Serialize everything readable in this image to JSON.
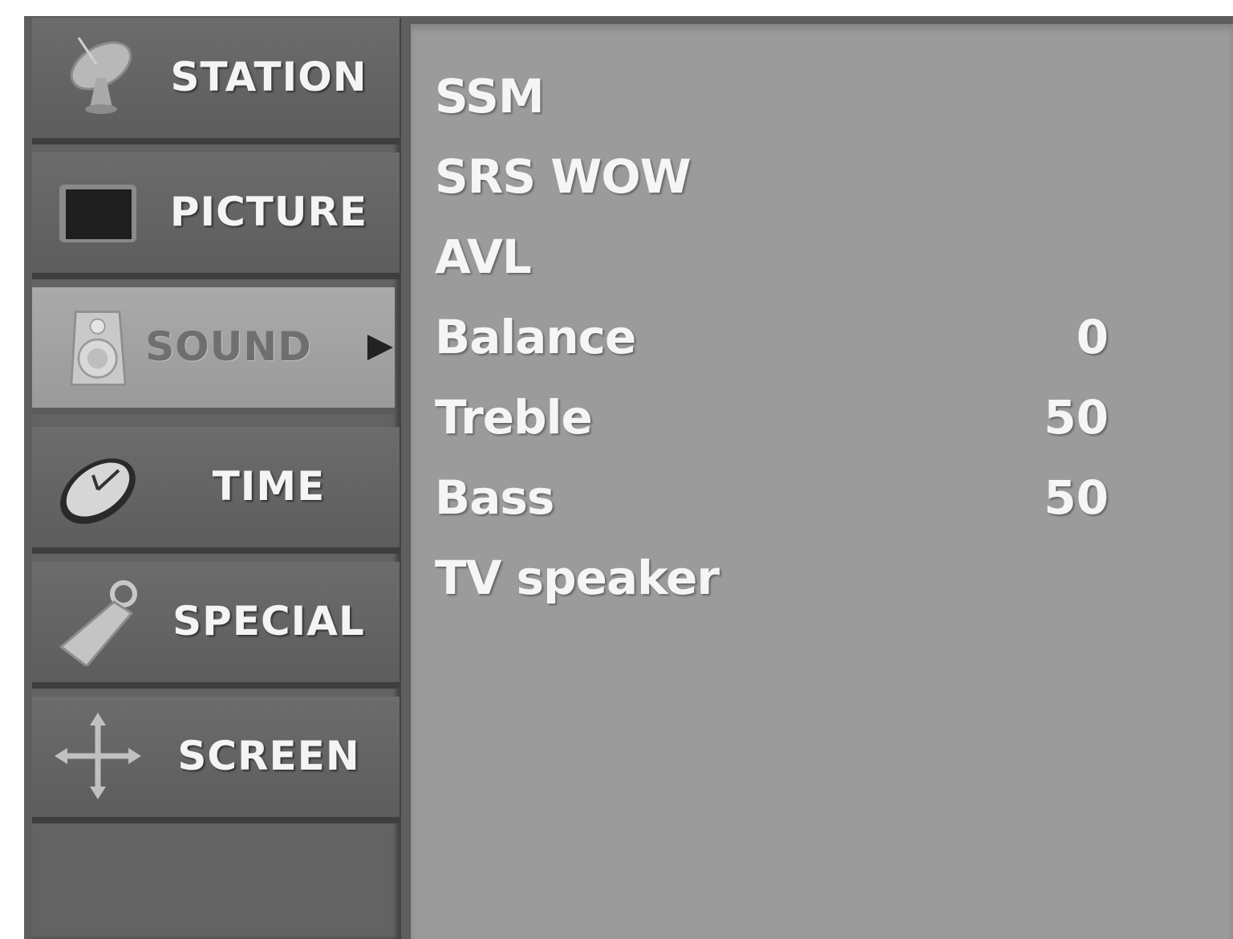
{
  "sidebar": {
    "items": [
      {
        "label": "STATION",
        "icon": "satellite-dish-icon"
      },
      {
        "label": "PICTURE",
        "icon": "screen-icon"
      },
      {
        "label": "SOUND",
        "icon": "speaker-icon",
        "selected": true
      },
      {
        "label": "TIME",
        "icon": "clock-icon"
      },
      {
        "label": "SPECIAL",
        "icon": "key-tag-icon"
      },
      {
        "label": "SCREEN",
        "icon": "move-arrows-icon"
      }
    ]
  },
  "sound_menu": {
    "options": [
      {
        "label": "SSM",
        "value": ""
      },
      {
        "label": "SRS WOW",
        "value": ""
      },
      {
        "label": "AVL",
        "value": ""
      },
      {
        "label": "Balance",
        "value": "0"
      },
      {
        "label": "Treble",
        "value": "50"
      },
      {
        "label": "Bass",
        "value": "50"
      },
      {
        "label": "TV speaker",
        "value": ""
      }
    ]
  },
  "colors": {
    "sidebar_bg": "#636363",
    "selected_bg": "#a3a3a3",
    "panel_bg": "#9b9b9b",
    "text": "#f5f5f5"
  }
}
